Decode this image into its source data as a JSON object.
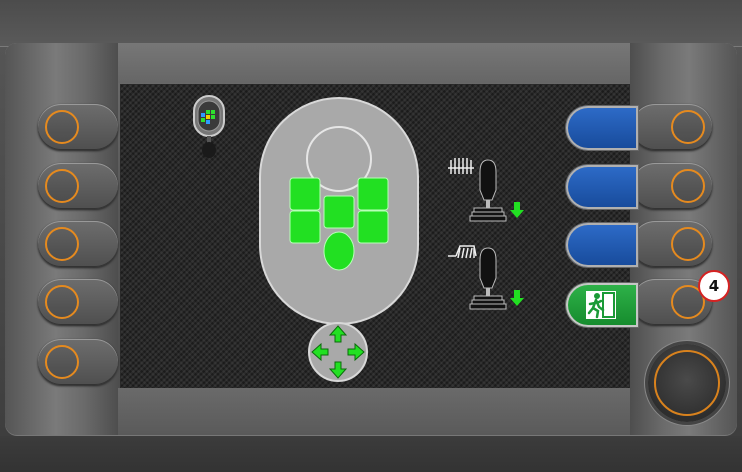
{
  "colors": {
    "accent_ring": "#e58a1f",
    "active_green": "#22e022",
    "button_blue": "#1f5bb3",
    "exit_green": "#1fa03a",
    "badge_border": "#d52222"
  },
  "left_softkeys": [
    {
      "name": "left-softkey-1"
    },
    {
      "name": "left-softkey-2"
    },
    {
      "name": "left-softkey-3"
    },
    {
      "name": "left-softkey-4"
    },
    {
      "name": "left-softkey-5"
    }
  ],
  "right_softkeys": [
    {
      "name": "right-softkey-1"
    },
    {
      "name": "right-softkey-2"
    },
    {
      "name": "right-softkey-3"
    },
    {
      "name": "right-softkey-4"
    }
  ],
  "screen": {
    "mode_switch_icon": "joystick-mode-switch-icon",
    "head_panel_icon": "head-section-selector-icon",
    "nav_icon": "four-direction-arrows-icon",
    "joystick_top_icon": "rake-joystick-down-icon",
    "joystick_bottom_icon": "brush-joystick-down-icon",
    "blue_buttons": [
      "function-1",
      "function-2",
      "function-3"
    ],
    "exit_icon": "emergency-exit-icon"
  },
  "badge": {
    "label": "4"
  }
}
